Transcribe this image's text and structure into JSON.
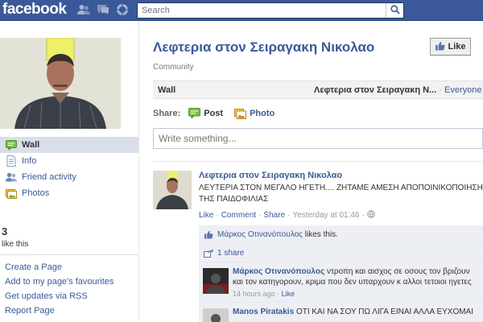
{
  "topbar": {
    "logo": "facebook",
    "search": {
      "placeholder": "Search",
      "value": ""
    },
    "icons": [
      "friend-requests-icon",
      "messages-icon",
      "notifications-icon",
      "search-icon"
    ]
  },
  "sidebar": {
    "nav": [
      {
        "label": "Wall",
        "icon": "wall-icon",
        "active": true
      },
      {
        "label": "Info",
        "icon": "info-icon",
        "active": false
      },
      {
        "label": "Friend activity",
        "icon": "friends-icon",
        "active": false
      },
      {
        "label": "Photos",
        "icon": "photos-icon",
        "active": false
      }
    ],
    "likes_count": "3",
    "likes_label": "like this",
    "links": [
      "Create a Page",
      "Add to my page's favourites",
      "Get updates via RSS",
      "Report Page"
    ]
  },
  "page": {
    "title": "Λεφτερια στον Σειραγακη Νικολαο",
    "like_label": "Like",
    "category": "Community"
  },
  "wall": {
    "tab": "Wall",
    "filter_name": "Λεφτερια στον Σειραγακη N...",
    "filter_everyone": "Everyone"
  },
  "share": {
    "label": "Share:",
    "post": "Post",
    "photo": "Photo",
    "composer_placeholder": "Write something..."
  },
  "story": {
    "author": "Λεφτερια στον Σειραγακη Νικολαο",
    "text": "ΛΕΥΤΕΡΙΑ ΣΤΟΝ ΜΕΓΑΛΟ ΗΓΕΤΗ.... ΖΗΤΑΜΕ ΑΜΕΣΗ ΑΠΟΠΟΙΝΙΚΟΠΟΙΗΣΗ ΤΗΣ ΠΑΙΔΟΦΙΛΙΑΣ",
    "meta": {
      "like": "Like",
      "comment": "Comment",
      "share": "Share",
      "time": "Yesterday at 01:46"
    },
    "likes_line": {
      "name": "Μάρκος Οτινανόπουλος",
      "suffix": "likes this."
    },
    "shares_line": "1 share",
    "comments": [
      {
        "author": "Μάρκος Οτινανόπουλος",
        "text": "ντροπη και αισχος σε οσους τον βριζουν και τον κατηγορουν, κριμα που δεν υπαρχουν κ αλλοι τετοιοι ηγετες",
        "time": "14 hours ago",
        "like": "Like"
      },
      {
        "author": "Manos Piratakis",
        "text": "ΟΤΙ ΚΑΙ ΝΑ ΣΟΥ ΠΩ ΛΙΓΑ ΕΙΝΑΙ ΑΛΛΑ ΕΥΧΟΜΑΙ"
      }
    ]
  },
  "colors": {
    "brand": "#3b5998",
    "brand_dark": "#29447e",
    "nav_active": "#d8dfea",
    "ufi_bg": "#edeff4"
  }
}
